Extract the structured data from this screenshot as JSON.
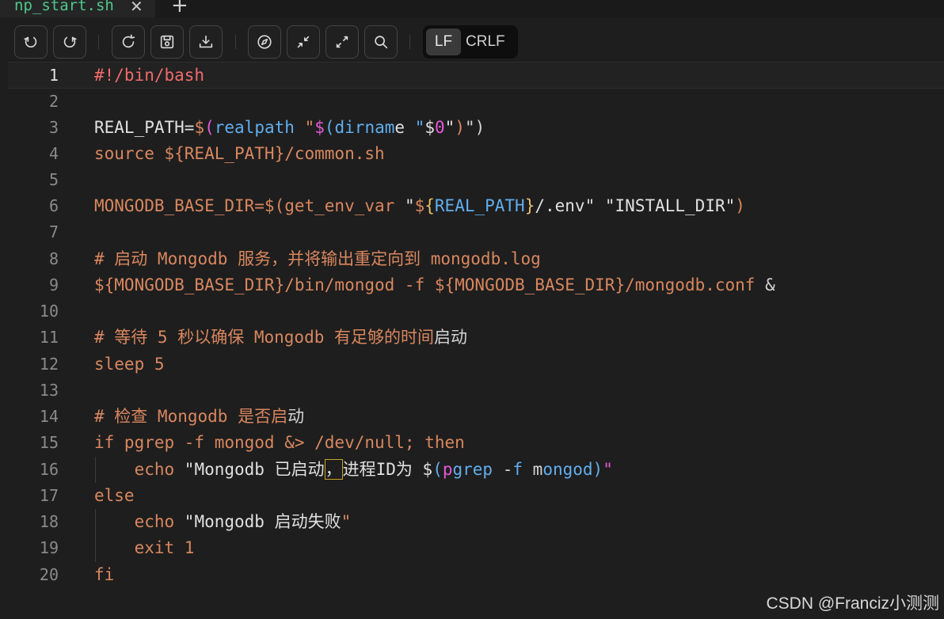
{
  "tab": {
    "title": "np_start.sh",
    "close_icon": "close-icon",
    "new_tab_icon": "plus-icon"
  },
  "toolbar": {
    "buttons": [
      {
        "name": "undo",
        "icon": "undo-icon"
      },
      {
        "name": "redo",
        "icon": "redo-icon"
      },
      {
        "name": "reload",
        "icon": "reload-icon"
      },
      {
        "name": "save",
        "icon": "save-icon"
      },
      {
        "name": "download",
        "icon": "download-icon"
      },
      {
        "name": "compass",
        "icon": "compass-icon"
      },
      {
        "name": "collapse",
        "icon": "collapse-icon"
      },
      {
        "name": "expand",
        "icon": "expand-icon"
      },
      {
        "name": "search",
        "icon": "search-icon"
      }
    ],
    "eol": {
      "lf": "LF",
      "crlf": "CRLF",
      "selected": "LF"
    }
  },
  "editor": {
    "current_line": 1,
    "line_numbers": [
      "1",
      "2",
      "3",
      "4",
      "5",
      "6",
      "7",
      "8",
      "9",
      "10",
      "11",
      "12",
      "13",
      "14",
      "15",
      "16",
      "17",
      "18",
      "19",
      "20"
    ],
    "lines": [
      "#!/bin/bash",
      "",
      "REAL_PATH=$(realpath \"$(dirname \"$0\")\")",
      "source ${REAL_PATH}/common.sh",
      "",
      "MONGODB_BASE_DIR=$(get_env_var \"${REAL_PATH}/.env\" \"INSTALL_DIR\")",
      "",
      "# 启动 Mongodb 服务，并将输出重定向到 mongodb.log",
      "${MONGODB_BASE_DIR}/bin/mongod -f ${MONGODB_BASE_DIR}/mongodb.conf &",
      "",
      "# 等待 5 秒以确保 Mongodb 有足够的时间启动",
      "sleep 5",
      "",
      "# 检查 Mongodb 是否启动",
      "if pgrep -f mongod &> /dev/null; then",
      "    echo \"Mongodb 已启动，进程ID为 $(pgrep -f mongod)\"",
      "else",
      "    echo \"Mongodb 启动失败\"",
      "    exit 1",
      "fi"
    ]
  },
  "watermark": "CSDN @Franciz小测测",
  "colors": {
    "background": "#1e1e1e",
    "tab_title": "#4ec98a",
    "keyword_orange": "#d9875f",
    "shebang_red": "#f06a6a",
    "command_blue": "#61aeee",
    "subshell_magenta": "#e35ad8"
  }
}
